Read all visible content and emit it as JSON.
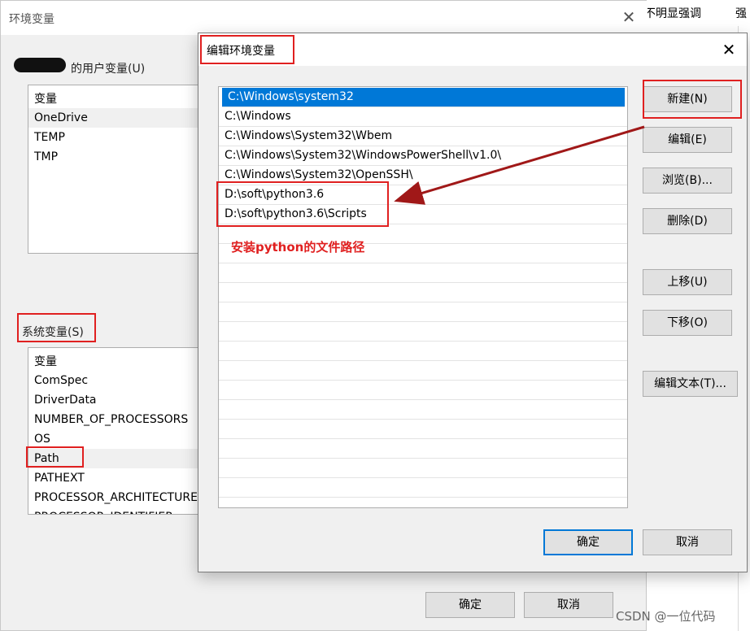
{
  "background_app": {
    "text_1": "不明显强调",
    "text_2": "强"
  },
  "env_dialog": {
    "title": "环境变量",
    "close_glyph": "✕",
    "user_group_label": "的用户变量(U)",
    "user_list": {
      "header": "变量",
      "rows": [
        "OneDrive",
        "TEMP",
        "TMP"
      ]
    },
    "system_group_label": "系统变量(S)",
    "system_list": {
      "header": "变量",
      "rows": [
        "ComSpec",
        "DriverData",
        "NUMBER_OF_PROCESSORS",
        "OS",
        "Path",
        "PATHEXT",
        "PROCESSOR_ARCHITECTURE",
        "PROCESSOR_IDENTIFIER"
      ]
    },
    "ok_label": "确定",
    "cancel_label": "取消"
  },
  "edit_dialog": {
    "title": "编辑环境变量",
    "close_glyph": "✕",
    "paths": [
      "C:\\Windows\\system32",
      "C:\\Windows",
      "C:\\Windows\\System32\\Wbem",
      "C:\\Windows\\System32\\WindowsPowerShell\\v1.0\\",
      "C:\\Windows\\System32\\OpenSSH\\",
      "D:\\soft\\python3.6",
      "D:\\soft\\python3.6\\Scripts"
    ],
    "buttons": {
      "new": "新建(N)",
      "edit": "编辑(E)",
      "browse": "浏览(B)...",
      "delete": "删除(D)",
      "move_up": "上移(U)",
      "move_down": "下移(O)",
      "edit_text": "编辑文本(T)..."
    },
    "ok_label": "确定",
    "cancel_label": "取消"
  },
  "annotation": {
    "text": "安装python的文件路径",
    "color": "#e02020"
  },
  "watermark": "CSDN @一位代码",
  "colors": {
    "selection": "#0078d7",
    "annotation_red": "#e02020",
    "dialog_bg": "#f0f0f0"
  }
}
